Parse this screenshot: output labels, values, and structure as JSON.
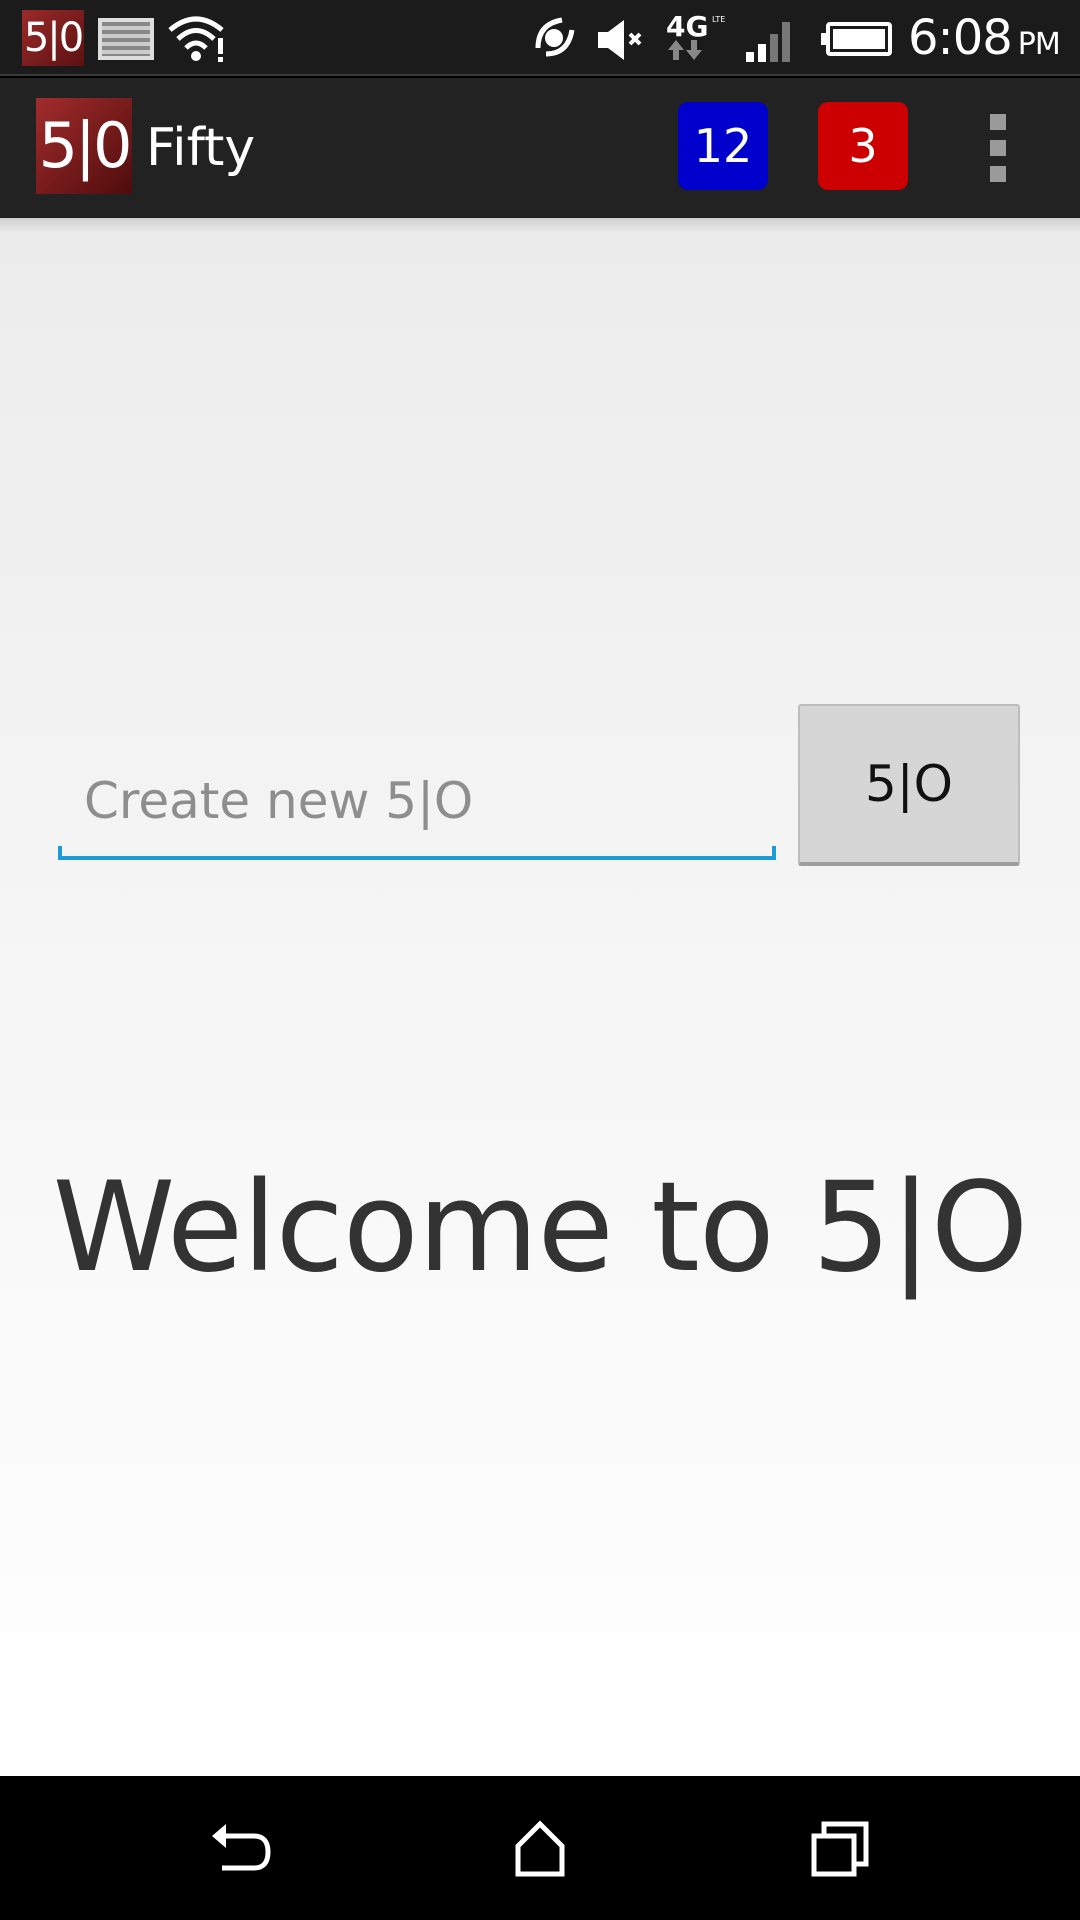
{
  "status_bar": {
    "app_icon_text": "5|0",
    "time": "6:08",
    "ampm": "PM",
    "network": "4G LTE",
    "icons": [
      "app-notification-icon",
      "image-icon",
      "wifi-icon",
      "nfc-icon",
      "mute-icon",
      "lte-icon",
      "signal-icon",
      "battery-icon"
    ]
  },
  "action_bar": {
    "logo_text": "5|0",
    "title": "Fifty",
    "badge_blue": "12",
    "badge_red": "3",
    "colors": {
      "badge_blue": "#0000cc",
      "badge_red": "#cc0000"
    }
  },
  "main": {
    "input_placeholder": "Create new 5|O",
    "input_value": "",
    "button_label": "5|O",
    "welcome_text": "Welcome to 5|O"
  },
  "nav_bar": {
    "icons": [
      "back-icon",
      "home-icon",
      "recent-apps-icon"
    ]
  }
}
